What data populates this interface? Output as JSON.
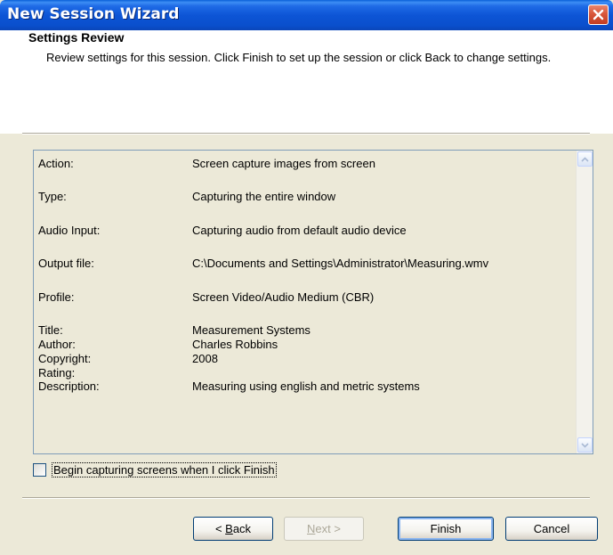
{
  "window": {
    "title": "New Session Wizard"
  },
  "header": {
    "title": "Settings Review",
    "description": "Review settings for this session. Click Finish to set up the session or click Back to change settings."
  },
  "settings": {
    "action": {
      "label": "Action:",
      "value": "Screen capture images from screen"
    },
    "type": {
      "label": "Type:",
      "value": "Capturing the entire window"
    },
    "audio_input": {
      "label": "Audio Input:",
      "value": "Capturing audio from default audio device"
    },
    "output_file": {
      "label": "Output file:",
      "value": "C:\\Documents and Settings\\Administrator\\Measuring.wmv"
    },
    "profile": {
      "label": "Profile:",
      "value": "Screen Video/Audio Medium (CBR)"
    },
    "title": {
      "label": "Title:",
      "value": "Measurement Systems"
    },
    "author": {
      "label": "Author:",
      "value": "Charles Robbins"
    },
    "copyright": {
      "label": "Copyright:",
      "value": "2008"
    },
    "rating": {
      "label": "Rating:",
      "value": ""
    },
    "description": {
      "label": "Description:",
      "value": "Measuring using english and metric systems"
    }
  },
  "checkbox": {
    "label": "Begin capturing screens when I click Finish",
    "checked": false
  },
  "buttons": {
    "back": {
      "prefix": "< ",
      "accel": "B",
      "rest": "ack"
    },
    "next": {
      "accel": "N",
      "rest": "ext >"
    },
    "finish": "Finish",
    "cancel": "Cancel"
  },
  "colors": {
    "titlebar": "#0a55d6",
    "dialog_bg": "#ece9d8",
    "close_button": "#d8573b"
  }
}
